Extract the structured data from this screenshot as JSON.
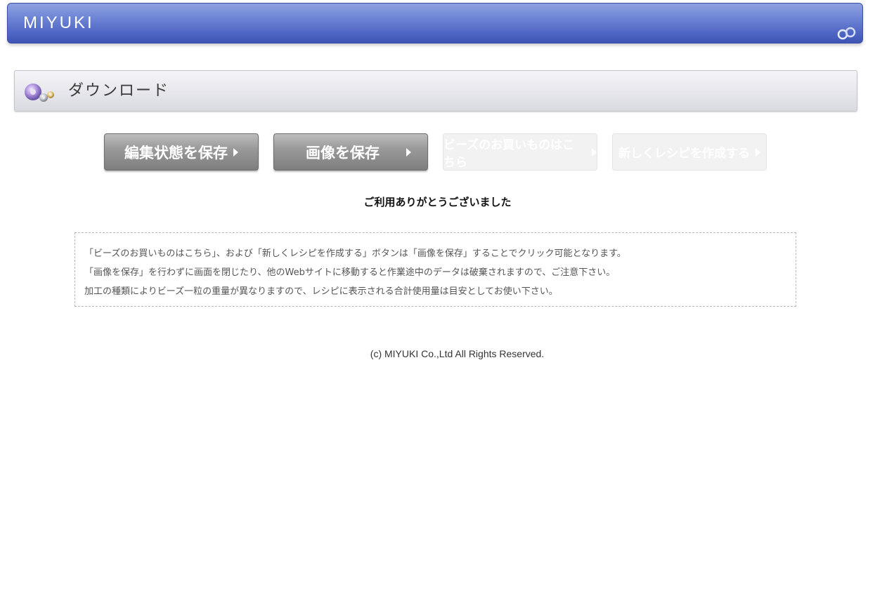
{
  "header": {
    "logo": "MIYUKI",
    "rings_icon": "rings-icon"
  },
  "section": {
    "title": "ダウンロード",
    "icon": "beads-icon"
  },
  "buttons": {
    "save_state": "編集状態を保存",
    "save_image": "画像を保存",
    "buy_beads": "ビーズのお買いものはこちら",
    "new_recipe": "新しくレシピを作成する"
  },
  "thanks": "ご利用ありがとうございました",
  "notice": [
    "「ビーズのお買いものはこちら」、および「新しくレシピを作成する」ボタンは「画像を保存」することでクリック可能となります。",
    "「画像を保存」を行わずに画面を閉じたり、他のWebサイトに移動すると作業途中のデータは破棄されますので、ご注意下さい。",
    "加工の種類によりビーズ一粒の重量が異なりますので、レシピに表示される合計使用量は目安としてお使い下さい。"
  ],
  "footer": "(c) MIYUKI Co.,Ltd All Rights Reserved.",
  "colors": {
    "header_blue": "#5066c4",
    "button_gray": "#8f8f8f",
    "disabled_button": "#f2f2f3"
  }
}
